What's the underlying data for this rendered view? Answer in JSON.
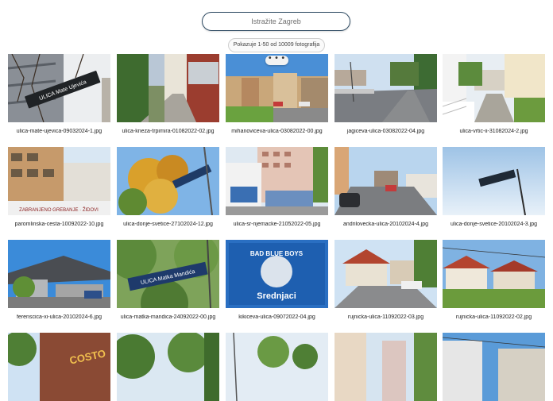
{
  "search": {
    "placeholder": "Istražite Zagreb"
  },
  "results": {
    "count_text": "Pokazuje 1-50 od 10009 fotografija"
  },
  "more_button_label": "• • •",
  "photos": [
    {
      "filename": "ulica-mate-ujevica-09032024-1.jpg",
      "sign": "ULICA Mate Ujevića"
    },
    {
      "filename": "ulica-kneza-trpimira-01082022-02.jpg"
    },
    {
      "filename": "mihanoviceva-ulica-03082022-00.jpg"
    },
    {
      "filename": "jagiceva-ulica-03082022-04.jpg"
    },
    {
      "filename": "ulica-vrtic-ii-31082024-2.jpg"
    },
    {
      "filename": "paromlinska-cesta-10092022-10.jpg",
      "sign": "ZABRANJENO GREBANJE · ŽIDOVI"
    },
    {
      "filename": "ulica-donje-svetice-27102024-12.jpg"
    },
    {
      "filename": "ulica-sr-njemacke-21052022-05.jpg"
    },
    {
      "filename": "andrilovecka-ulica-20102024-4.jpg"
    },
    {
      "filename": "ulica-donje-svetice-20102024-3.jpg"
    },
    {
      "filename": "ferenscica-xi-ulica-20102024-6.jpg"
    },
    {
      "filename": "ulica-matka-mandica-24092022-00.jpg",
      "sign": "ULICA Matka Mandića"
    },
    {
      "filename": "kikiceva-ulica-09072022-04.jpg",
      "sign_top": "BAD BLUE BOYS",
      "sign_bottom": "Srednjaci"
    },
    {
      "filename": "rujnicka-ulica-11092022-03.jpg"
    },
    {
      "filename": "rujnicka-ulica-11092022-02.jpg"
    },
    {
      "filename": "",
      "sign": "COSTO"
    },
    {
      "filename": ""
    },
    {
      "filename": ""
    },
    {
      "filename": ""
    },
    {
      "filename": ""
    }
  ]
}
